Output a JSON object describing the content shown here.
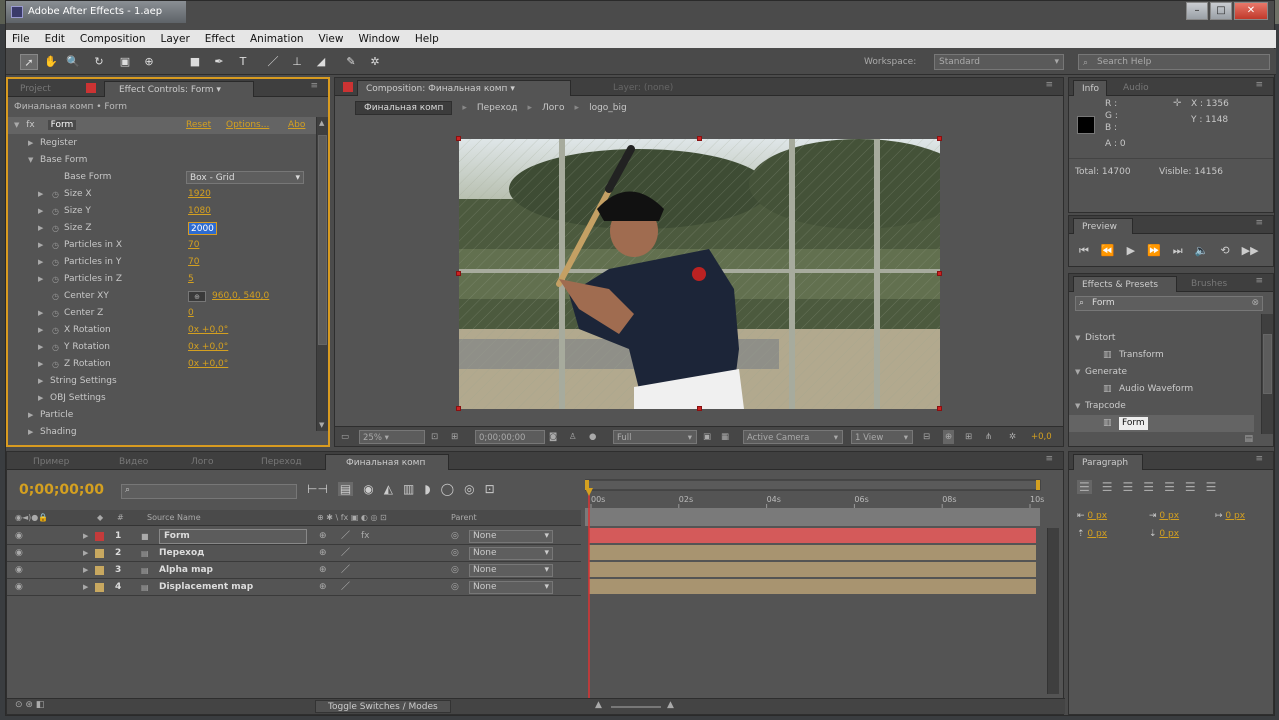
{
  "window": {
    "title": "Adobe After Effects - 1.aep",
    "controls": [
      "–",
      "□",
      "✕"
    ]
  },
  "menu": [
    "File",
    "Edit",
    "Composition",
    "Layer",
    "Effect",
    "Animation",
    "View",
    "Window",
    "Help"
  ],
  "toolbar": {
    "workspace_label": "Workspace:",
    "workspace_value": "Standard",
    "search_placeholder": "Search Help"
  },
  "left_panel": {
    "tabs": [
      "Project",
      "Effect Controls: Form"
    ],
    "header": "Финальная комп • Form",
    "effect_name": "Form",
    "effect_links": [
      "Reset",
      "Options...",
      "Abo"
    ],
    "rows": [
      {
        "label": "Register",
        "value": "",
        "indent": 1,
        "kind": "group"
      },
      {
        "label": "Base Form",
        "value": "",
        "indent": 1,
        "kind": "group-open"
      },
      {
        "label": "Base Form",
        "value": "Box - Grid",
        "indent": 3,
        "kind": "dropdown"
      },
      {
        "label": "Size X",
        "value": "1920",
        "indent": 3,
        "kind": "prop"
      },
      {
        "label": "Size Y",
        "value": "1080",
        "indent": 3,
        "kind": "prop"
      },
      {
        "label": "Size Z",
        "value": "2000",
        "indent": 3,
        "kind": "editing"
      },
      {
        "label": "Particles in X",
        "value": "70",
        "indent": 3,
        "kind": "prop"
      },
      {
        "label": "Particles in Y",
        "value": "70",
        "indent": 3,
        "kind": "prop"
      },
      {
        "label": "Particles in Z",
        "value": "5",
        "indent": 3,
        "kind": "prop"
      },
      {
        "label": "Center XY",
        "value": "960,0, 540,0",
        "indent": 3,
        "kind": "point"
      },
      {
        "label": "Center Z",
        "value": "0",
        "indent": 3,
        "kind": "prop"
      },
      {
        "label": "X Rotation",
        "value": "0x +0,0°",
        "indent": 3,
        "kind": "prop"
      },
      {
        "label": "Y Rotation",
        "value": "0x +0,0°",
        "indent": 3,
        "kind": "prop"
      },
      {
        "label": "Z Rotation",
        "value": "0x +0,0°",
        "indent": 3,
        "kind": "prop"
      },
      {
        "label": "String Settings",
        "value": "",
        "indent": 2,
        "kind": "group"
      },
      {
        "label": "OBJ Settings",
        "value": "",
        "indent": 2,
        "kind": "group"
      },
      {
        "label": "Particle",
        "value": "",
        "indent": 1,
        "kind": "group"
      },
      {
        "label": "Shading",
        "value": "",
        "indent": 1,
        "kind": "group"
      }
    ]
  },
  "composition": {
    "tabs": [
      "Composition: Финальная комп",
      "Layer: (none)"
    ],
    "breadcrumbs": [
      "Финальная комп",
      "Переход",
      "Лого",
      "logo_big"
    ],
    "footer": {
      "zoom": "25%",
      "timecode": "0;00;00;00",
      "resolution": "Full",
      "camera": "Active Camera",
      "view": "1 View",
      "offset": "+0,0"
    }
  },
  "info_panel": {
    "tabs": [
      "Info",
      "Audio"
    ],
    "r": "R :",
    "g": "G :",
    "b": "B :",
    "a": "A : 0",
    "x": "X : 1356",
    "y": "Y : 1148",
    "total": "Total: 14700",
    "visible": "Visible: 14156"
  },
  "preview_panel": {
    "tab": "Preview"
  },
  "effects_panel": {
    "tabs": [
      "Effects & Presets",
      "Brushes"
    ],
    "search": "Form",
    "items": [
      {
        "label": "Distort",
        "kind": "category"
      },
      {
        "label": "Transform",
        "kind": "effect"
      },
      {
        "label": "Generate",
        "kind": "category"
      },
      {
        "label": "Audio Waveform",
        "kind": "effect"
      },
      {
        "label": "Trapcode",
        "kind": "category"
      },
      {
        "label": "Form",
        "kind": "effect-selected"
      }
    ]
  },
  "paragraph_panel": {
    "tab": "Paragraph",
    "fields": [
      "0 px",
      "0 px",
      "0 px",
      "0 px",
      "0 px"
    ]
  },
  "timeline": {
    "tabs": [
      "Пример",
      "Видео",
      "Лого",
      "Переход",
      "Финальная комп"
    ],
    "timecode": "0;00;00;00",
    "columns": {
      "name": "Source Name",
      "parent": "Parent"
    },
    "ruler": [
      "00s",
      "02s",
      "04s",
      "06s",
      "08s",
      "10s"
    ],
    "layers": [
      {
        "num": "1",
        "name": "Form",
        "parent": "None",
        "color": "#c43b3b",
        "bar": "#d45a5a"
      },
      {
        "num": "2",
        "name": "Переход",
        "parent": "None",
        "color": "#c8a860",
        "bar": "#a89470"
      },
      {
        "num": "3",
        "name": "Alpha map",
        "parent": "None",
        "color": "#c8a860",
        "bar": "#a89470"
      },
      {
        "num": "4",
        "name": "Displacement map",
        "parent": "None",
        "color": "#c8a860",
        "bar": "#a89470"
      }
    ],
    "footer": "Toggle Switches / Modes"
  }
}
